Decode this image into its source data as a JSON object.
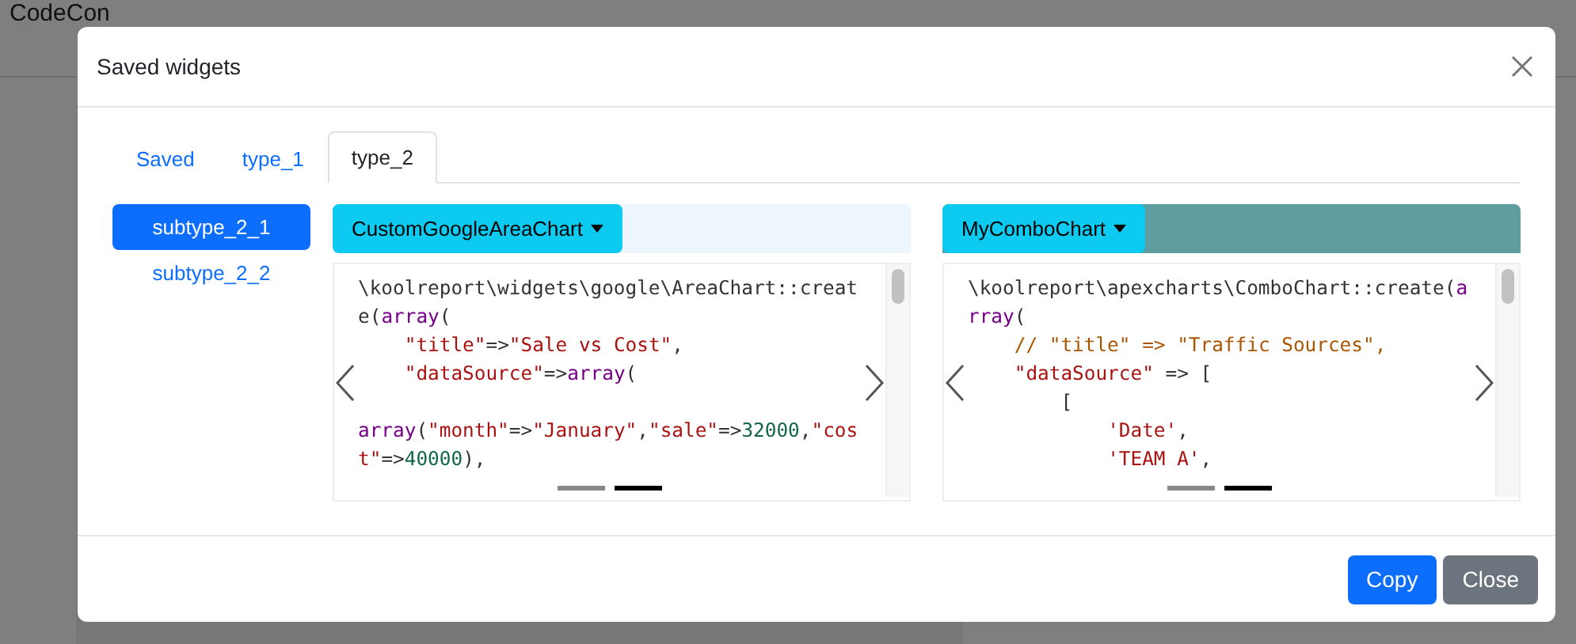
{
  "app_bar": {
    "brand": "CodeCon"
  },
  "modal": {
    "title": "Saved widgets",
    "tabs": [
      {
        "label": "Saved",
        "selected": false
      },
      {
        "label": "type_1",
        "selected": false
      },
      {
        "label": "type_2",
        "selected": true
      }
    ],
    "subtypes": [
      {
        "label": "subtype_2_1",
        "selected": true
      },
      {
        "label": "subtype_2_2",
        "selected": false
      }
    ],
    "widgets": [
      {
        "name": "CustomGoogleAreaChart",
        "color": "#eef6fd",
        "indicators": [
          {
            "selected": false
          },
          {
            "selected": true
          }
        ],
        "code": [
          [
            {
              "text": "\\koolreport\\widgets\\google\\AreaChart::create(",
              "kind": "plain"
            },
            {
              "text": "array",
              "kind": "keyword"
            },
            {
              "text": "(",
              "kind": "plain"
            }
          ],
          [
            {
              "text": "    \"title\"",
              "kind": "string"
            },
            {
              "text": "=>",
              "kind": "plain"
            },
            {
              "text": "\"Sale vs Cost\"",
              "kind": "string"
            },
            {
              "text": ",",
              "kind": "plain"
            }
          ],
          [
            {
              "text": "    \"dataSource\"",
              "kind": "string"
            },
            {
              "text": "=>",
              "kind": "plain"
            },
            {
              "text": "array",
              "kind": "keyword"
            },
            {
              "text": "(",
              "kind": "plain"
            }
          ],
          [
            {
              "text": "        array",
              "kind": "keyword"
            },
            {
              "text": "(",
              "kind": "plain"
            },
            {
              "text": "\"month\"",
              "kind": "string"
            },
            {
              "text": "=>",
              "kind": "plain"
            },
            {
              "text": "\"January\"",
              "kind": "string"
            },
            {
              "text": ",",
              "kind": "plain"
            },
            {
              "text": "\"sale\"",
              "kind": "string"
            },
            {
              "text": "=>",
              "kind": "plain"
            },
            {
              "text": "32000",
              "kind": "number"
            },
            {
              "text": ",",
              "kind": "plain"
            },
            {
              "text": "\"cost\"",
              "kind": "string"
            },
            {
              "text": "=>",
              "kind": "plain"
            },
            {
              "text": "40000",
              "kind": "number"
            },
            {
              "text": "),",
              "kind": "plain"
            }
          ]
        ]
      },
      {
        "name": "MyComboChart",
        "color": "#5f9ea0",
        "indicators": [
          {
            "selected": false
          },
          {
            "selected": true
          }
        ],
        "code": [
          [
            {
              "text": "\\koolreport\\apexcharts\\ComboChart::create(",
              "kind": "plain"
            },
            {
              "text": "array",
              "kind": "keyword"
            },
            {
              "text": "(",
              "kind": "plain"
            }
          ],
          [
            {
              "text": "    // \"title\" => \"Traffic Sources\",",
              "kind": "comment"
            }
          ],
          [
            {
              "text": "    \"dataSource\"",
              "kind": "string"
            },
            {
              "text": " => [",
              "kind": "plain"
            }
          ],
          [
            {
              "text": "        [",
              "kind": "plain"
            }
          ],
          [
            {
              "text": "            'Date'",
              "kind": "string"
            },
            {
              "text": ",",
              "kind": "plain"
            }
          ],
          [
            {
              "text": "            'TEAM A'",
              "kind": "string"
            },
            {
              "text": ",",
              "kind": "plain"
            }
          ]
        ]
      }
    ],
    "buttons": [
      {
        "label": "Copy",
        "kind": "primary"
      },
      {
        "label": "Close",
        "kind": "secondary"
      }
    ]
  }
}
